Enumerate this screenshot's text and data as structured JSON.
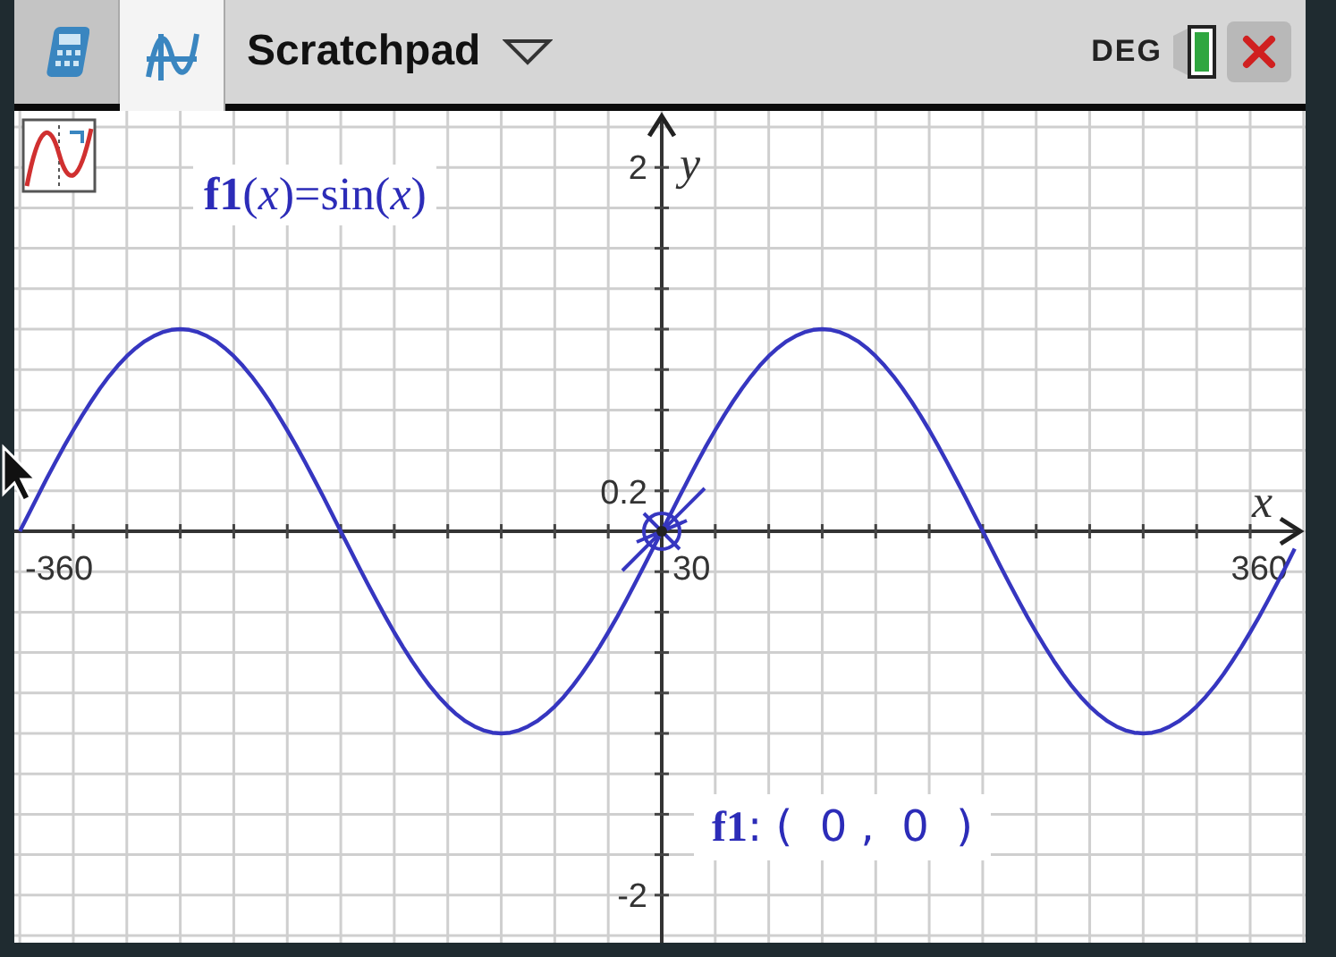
{
  "tabs": [
    {
      "kind": "calculator",
      "selected": false
    },
    {
      "kind": "graphs",
      "selected": true
    }
  ],
  "document": {
    "title": "Scratchpad"
  },
  "status": {
    "angle_mode": "DEG"
  },
  "graph": {
    "function_label": "**f1**(*x*)=sin(*x*)",
    "point_label": "**f1**: (  0 ,  0  )",
    "axis_labels": {
      "x": "x",
      "y": "y"
    },
    "tick_labels": [
      {
        "kind": "y-max",
        "text": "2"
      },
      {
        "kind": "y-step",
        "text": "0.2"
      },
      {
        "kind": "x-min",
        "text": "-360"
      },
      {
        "kind": "x-step",
        "text": "30"
      },
      {
        "kind": "x-max",
        "text": "360"
      },
      {
        "kind": "y-min",
        "text": "-2"
      }
    ]
  }
}
